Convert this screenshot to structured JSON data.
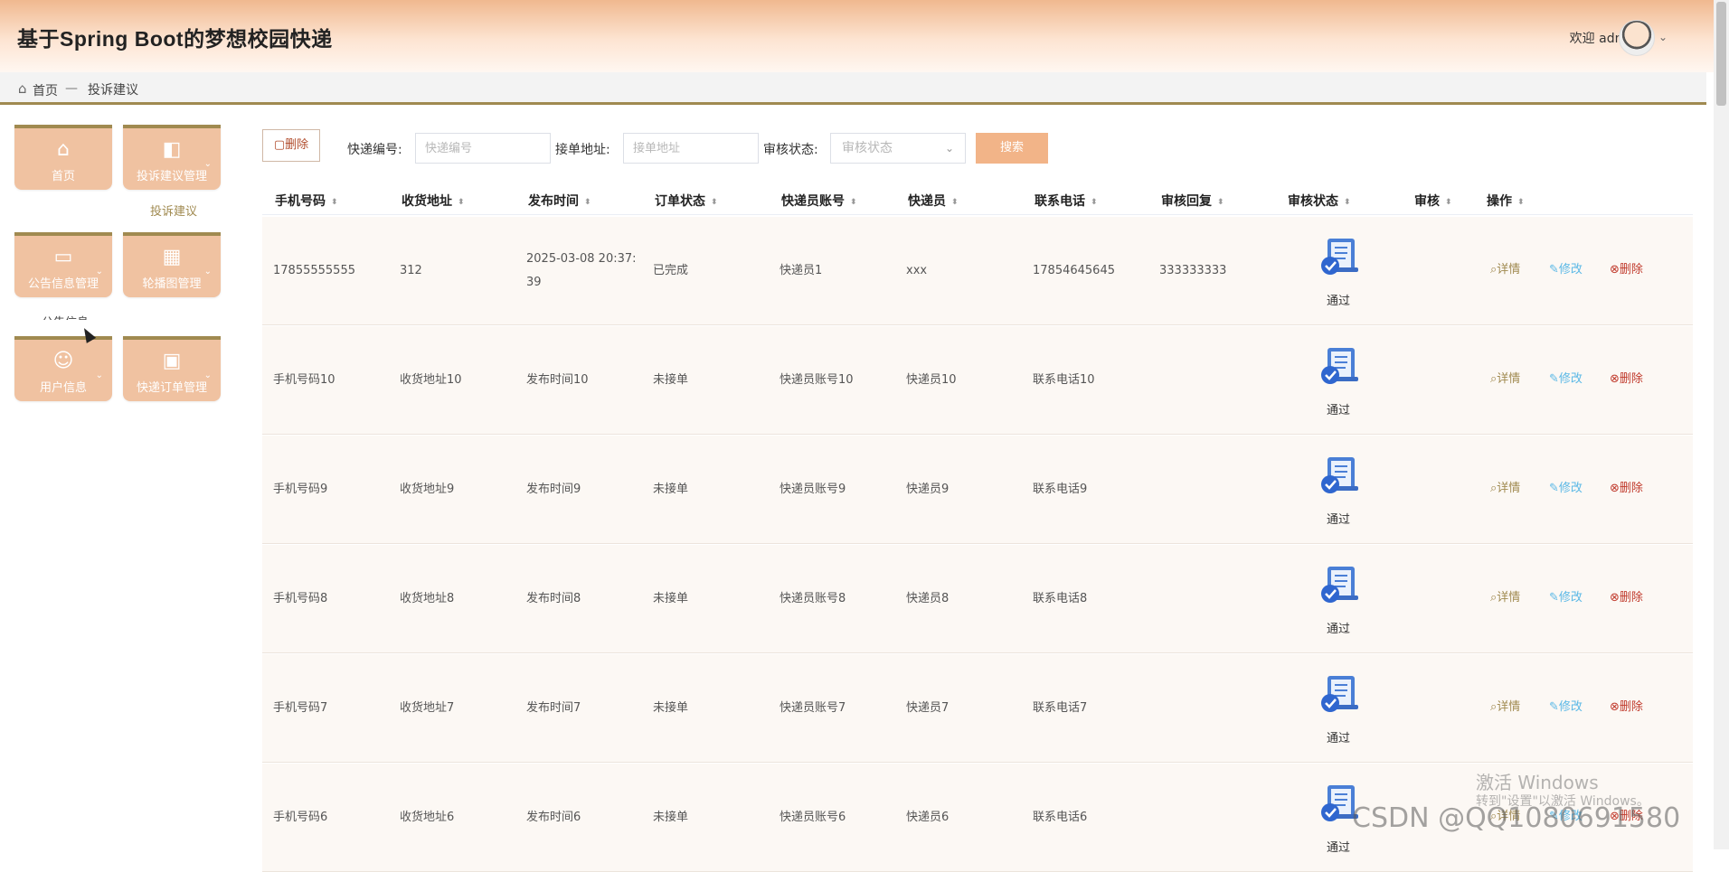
{
  "app": {
    "title": "基于Spring Boot的梦想校园快递",
    "welcome": "欢迎 admin",
    "caret": "⌄"
  },
  "breadcrumb": {
    "home": "首页",
    "separator": "—",
    "current": "投诉建议"
  },
  "sidebar": {
    "tiles": [
      {
        "label": "首页",
        "icon": "home-icon",
        "glyph": "⌂"
      },
      {
        "label": "投诉建议管理",
        "icon": "panel-icon",
        "glyph": "◧"
      },
      {
        "label": "公告信息管理",
        "icon": "notice-icon",
        "glyph": "▭"
      },
      {
        "label": "轮播图管理",
        "icon": "grid-icon",
        "glyph": "▦"
      },
      {
        "label": "用户信息",
        "icon": "user-icon",
        "glyph": "☺"
      },
      {
        "label": "快递订单管理",
        "icon": "briefcase-icon",
        "glyph": "▣"
      }
    ],
    "submenu_item": "投诉建议",
    "ghost_item": "公告信息"
  },
  "toolbar": {
    "delete_label": "删除",
    "field1_label": "快递编号:",
    "field1_placeholder": "快递编号",
    "field2_label": "接单地址:",
    "field2_placeholder": "接单地址",
    "field3_label": "审核状态:",
    "field3_placeholder": "审核状态",
    "search_label": "搜索"
  },
  "table": {
    "columns": [
      "手机号码",
      "收货地址",
      "发布时间",
      "订单状态",
      "快递员账号",
      "快递员",
      "联系电话",
      "审核回复",
      "审核状态",
      "审核",
      "操作"
    ],
    "rows": [
      {
        "phone": "17855555555",
        "address": "312",
        "time": "2025-03-08 20:37:39",
        "status": "已完成",
        "courier_account": "快递员1",
        "courier": "xxx",
        "contact": "17854645645",
        "reply": "333333333",
        "audit": "通过"
      },
      {
        "phone": "手机号码10",
        "address": "收货地址10",
        "time": "发布时间10",
        "status": "未接单",
        "courier_account": "快递员账号10",
        "courier": "快递员10",
        "contact": "联系电话10",
        "reply": "",
        "audit": "通过"
      },
      {
        "phone": "手机号码9",
        "address": "收货地址9",
        "time": "发布时间9",
        "status": "未接单",
        "courier_account": "快递员账号9",
        "courier": "快递员9",
        "contact": "联系电话9",
        "reply": "",
        "audit": "通过"
      },
      {
        "phone": "手机号码8",
        "address": "收货地址8",
        "time": "发布时间8",
        "status": "未接单",
        "courier_account": "快递员账号8",
        "courier": "快递员8",
        "contact": "联系电话8",
        "reply": "",
        "audit": "通过"
      },
      {
        "phone": "手机号码7",
        "address": "收货地址7",
        "time": "发布时间7",
        "status": "未接单",
        "courier_account": "快递员账号7",
        "courier": "快递员7",
        "contact": "联系电话7",
        "reply": "",
        "audit": "通过"
      },
      {
        "phone": "手机号码6",
        "address": "收货地址6",
        "time": "发布时间6",
        "status": "未接单",
        "courier_account": "快递员账号6",
        "courier": "快递员6",
        "contact": "联系电话6",
        "reply": "",
        "audit": "通过"
      }
    ],
    "actions": {
      "detail": "详情",
      "edit": "修改",
      "delete": "删除"
    }
  },
  "watermark": {
    "line1": "激活 Windows",
    "line2": "转到\"设置\"以激活 Windows。",
    "csdn": "CSDN @QQ1080691580"
  },
  "colors": {
    "accent": "#a08a50",
    "tile": "#f0c2a1",
    "search_button": "#f2b488",
    "row_bg": "#fcf8f4",
    "delete": "#c0392b",
    "edit": "#5ab8e6"
  }
}
